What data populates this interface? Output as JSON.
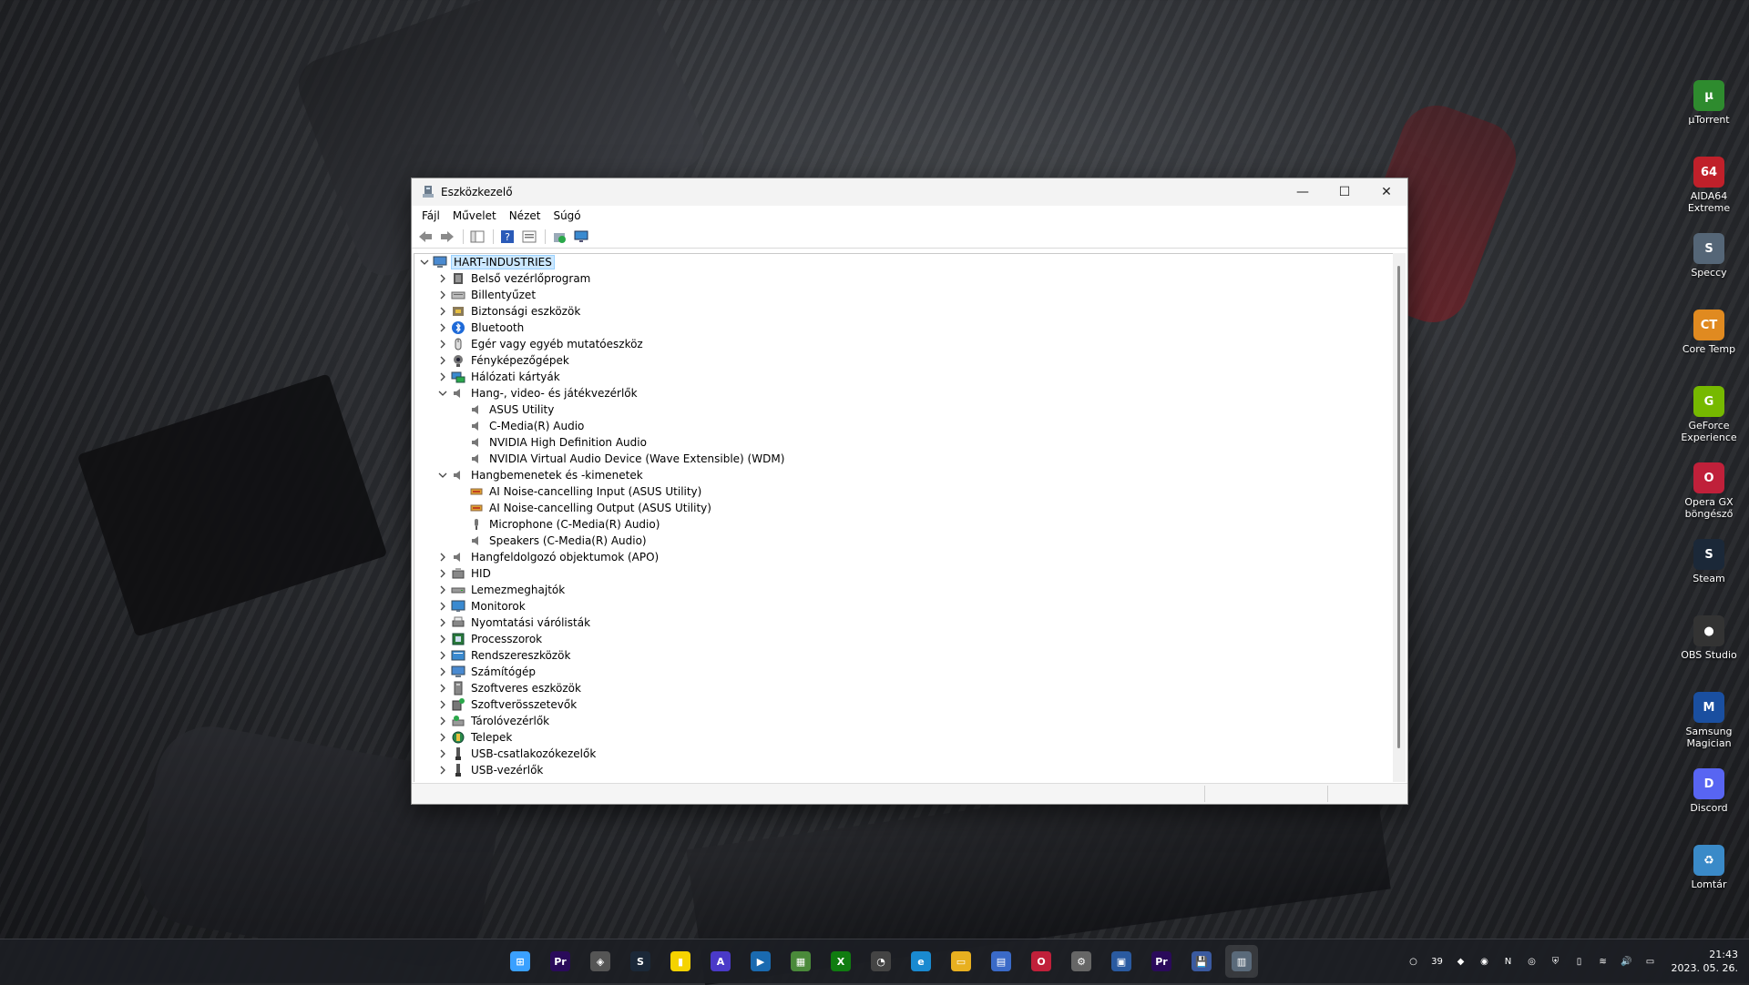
{
  "desktop_icons": [
    {
      "label": "µTorrent",
      "icon": "utorrent-icon",
      "color": "#2e8b2e",
      "glyph": "µ"
    },
    {
      "label": "AIDA64 Extreme",
      "icon": "aida64-icon",
      "color": "#c0202a",
      "glyph": "64"
    },
    {
      "label": "Speccy",
      "icon": "speccy-icon",
      "color": "#556677",
      "glyph": "S"
    },
    {
      "label": "Core Temp",
      "icon": "core-temp-icon",
      "color": "#e08a20",
      "glyph": "CT"
    },
    {
      "label": "GeForce Experience",
      "icon": "geforce-icon",
      "color": "#76b900",
      "glyph": "G"
    },
    {
      "label": "Opera GX böngésző",
      "icon": "opera-gx-icon",
      "color": "#c0203a",
      "glyph": "O"
    },
    {
      "label": "Steam",
      "icon": "steam-icon",
      "color": "#1b2838",
      "glyph": "S"
    },
    {
      "label": "OBS Studio",
      "icon": "obs-icon",
      "color": "#333",
      "glyph": "●"
    },
    {
      "label": "Samsung Magician",
      "icon": "samsung-magician-icon",
      "color": "#1a4fa0",
      "glyph": "M"
    },
    {
      "label": "Discord",
      "icon": "discord-icon",
      "color": "#5865f2",
      "glyph": "D"
    },
    {
      "label": "Lomtár",
      "icon": "recycle-bin-icon",
      "color": "#3a8ac8",
      "glyph": "♻"
    }
  ],
  "window": {
    "title": "Eszközkezelő",
    "minimize": "—",
    "maximize": "☐",
    "close": "✕",
    "menu": [
      "Fájl",
      "Művelet",
      "Nézet",
      "Súgó"
    ]
  },
  "tree": [
    {
      "label": "HART-INDUSTRIES",
      "level": 0,
      "expanded": true,
      "root": true,
      "icon": "computer-icon"
    },
    {
      "label": "Belső vezérlőprogram",
      "level": 1,
      "expanded": false,
      "icon": "firmware-icon"
    },
    {
      "label": "Billentyűzet",
      "level": 1,
      "expanded": false,
      "icon": "keyboard-icon"
    },
    {
      "label": "Biztonsági eszközök",
      "level": 1,
      "expanded": false,
      "icon": "security-device-icon"
    },
    {
      "label": "Bluetooth",
      "level": 1,
      "expanded": false,
      "icon": "bluetooth-icon"
    },
    {
      "label": "Egér vagy egyéb mutatóeszköz",
      "level": 1,
      "expanded": false,
      "icon": "mouse-icon"
    },
    {
      "label": "Fényképezőgépek",
      "level": 1,
      "expanded": false,
      "icon": "camera-icon"
    },
    {
      "label": "Hálózati kártyák",
      "level": 1,
      "expanded": false,
      "icon": "network-adapter-icon"
    },
    {
      "label": "Hang-, video- és játékvezérlők",
      "level": 1,
      "expanded": true,
      "icon": "speaker-icon"
    },
    {
      "label": "ASUS Utility",
      "level": 2,
      "icon": "speaker-icon"
    },
    {
      "label": "C-Media(R) Audio",
      "level": 2,
      "icon": "speaker-icon"
    },
    {
      "label": "NVIDIA High Definition Audio",
      "level": 2,
      "icon": "speaker-icon"
    },
    {
      "label": "NVIDIA Virtual Audio Device (Wave Extensible) (WDM)",
      "level": 2,
      "icon": "speaker-icon"
    },
    {
      "label": "Hangbemenetek és -kimenetek",
      "level": 1,
      "expanded": true,
      "icon": "speaker-icon"
    },
    {
      "label": "AI Noise-cancelling Input (ASUS Utility)",
      "level": 2,
      "icon": "audio-endpoint-icon"
    },
    {
      "label": "AI Noise-cancelling Output (ASUS Utility)",
      "level": 2,
      "icon": "audio-endpoint-icon"
    },
    {
      "label": "Microphone (C-Media(R) Audio)",
      "level": 2,
      "icon": "microphone-icon"
    },
    {
      "label": "Speakers (C-Media(R) Audio)",
      "level": 2,
      "icon": "speaker-icon"
    },
    {
      "label": "Hangfeldolgozó objektumok (APO)",
      "level": 1,
      "expanded": false,
      "icon": "speaker-icon"
    },
    {
      "label": "HID",
      "level": 1,
      "expanded": false,
      "icon": "hid-icon"
    },
    {
      "label": "Lemezmeghajtók",
      "level": 1,
      "expanded": false,
      "icon": "disk-drive-icon"
    },
    {
      "label": "Monitorok",
      "level": 1,
      "expanded": false,
      "icon": "monitor-icon"
    },
    {
      "label": "Nyomtatási várólisták",
      "level": 1,
      "expanded": false,
      "icon": "printer-icon"
    },
    {
      "label": "Processzorok",
      "level": 1,
      "expanded": false,
      "icon": "processor-icon"
    },
    {
      "label": "Rendszereszközök",
      "level": 1,
      "expanded": false,
      "icon": "system-device-icon"
    },
    {
      "label": "Számítógép",
      "level": 1,
      "expanded": false,
      "icon": "computer-icon"
    },
    {
      "label": "Szoftveres eszközök",
      "level": 1,
      "expanded": false,
      "icon": "software-device-icon"
    },
    {
      "label": "Szoftverösszetevők",
      "level": 1,
      "expanded": false,
      "icon": "software-component-icon"
    },
    {
      "label": "Tárolóvezérlők",
      "level": 1,
      "expanded": false,
      "icon": "storage-controller-icon"
    },
    {
      "label": "Telepek",
      "level": 1,
      "expanded": false,
      "icon": "battery-icon"
    },
    {
      "label": "USB-csatlakozókezelők",
      "level": 1,
      "expanded": false,
      "icon": "usb-icon"
    },
    {
      "label": "USB-vezérlők",
      "level": 1,
      "expanded": false,
      "icon": "usb-icon"
    }
  ],
  "taskbar": {
    "apps": [
      {
        "icon": "windows-start-icon",
        "color": "#3aa0ff",
        "glyph": "⊞"
      },
      {
        "icon": "premiere-pro-icon",
        "color": "#2a0a5a",
        "glyph": "Pr"
      },
      {
        "icon": "unity-icon",
        "color": "#555",
        "glyph": "◈"
      },
      {
        "icon": "steam-icon",
        "color": "#1b2838",
        "glyph": "S"
      },
      {
        "icon": "sticky-notes-icon",
        "color": "#f5d300",
        "glyph": "▮"
      },
      {
        "icon": "affinity-icon",
        "color": "#4a3ac8",
        "glyph": "A"
      },
      {
        "icon": "davinci-icon",
        "color": "#1a6ab0",
        "glyph": "▶"
      },
      {
        "icon": "minecraft-icon",
        "color": "#4a8a3a",
        "glyph": "▦"
      },
      {
        "icon": "xbox-icon",
        "color": "#107c10",
        "glyph": "X"
      },
      {
        "icon": "speedometer-icon",
        "color": "#444",
        "glyph": "◔"
      },
      {
        "icon": "edge-icon",
        "color": "#1a8ad0",
        "glyph": "e"
      },
      {
        "icon": "file-explorer-icon",
        "color": "#e8b020",
        "glyph": "▭"
      },
      {
        "icon": "microsoft-store-icon",
        "color": "#3a6ac8",
        "glyph": "▤"
      },
      {
        "icon": "opera-gx-icon",
        "color": "#c0203a",
        "glyph": "O"
      },
      {
        "icon": "settings-icon",
        "color": "#666",
        "glyph": "⚙"
      },
      {
        "icon": "remote-desktop-icon",
        "color": "#2a5aa0",
        "glyph": "▣"
      },
      {
        "icon": "premiere-pro-icon",
        "color": "#2a0a5a",
        "glyph": "Pr"
      },
      {
        "icon": "floppy-icon",
        "color": "#3a5aa0",
        "glyph": "💾"
      },
      {
        "icon": "device-manager-icon",
        "color": "#5a6a7a",
        "glyph": "▥",
        "active": true
      }
    ],
    "tray": [
      {
        "icon": "circle-tray-icon",
        "glyph": "○"
      },
      {
        "icon": "temperature-tray-icon",
        "glyph": "39"
      },
      {
        "icon": "nvidia-tray-icon",
        "glyph": "◆"
      },
      {
        "icon": "app-tray-icon",
        "glyph": "◉"
      },
      {
        "icon": "onenote-tray-icon",
        "glyph": "N"
      },
      {
        "icon": "security-tray-icon",
        "glyph": "◎"
      },
      {
        "icon": "shield-tray-icon",
        "glyph": "⛨"
      },
      {
        "icon": "usb-tray-icon",
        "glyph": "▯"
      },
      {
        "icon": "wifi-icon",
        "glyph": "≋"
      },
      {
        "icon": "volume-icon",
        "glyph": "🔊"
      },
      {
        "icon": "battery-tray-icon",
        "glyph": "▭"
      }
    ],
    "time": "21:43",
    "date": "2023. 05. 26."
  }
}
